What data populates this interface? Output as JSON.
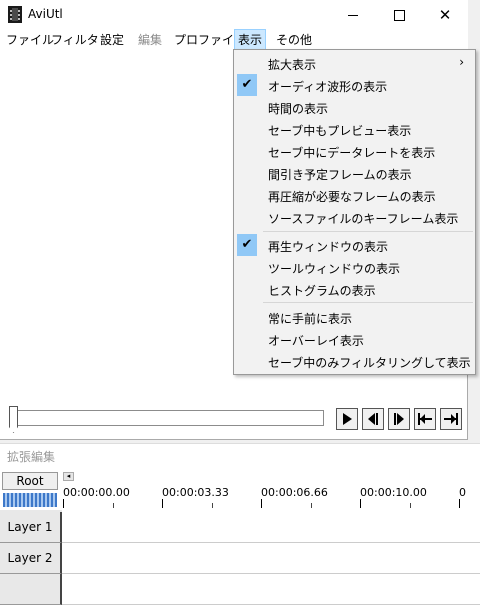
{
  "window": {
    "title": "AviUtl",
    "controls": {
      "minimize": "minimize",
      "maximize": "maximize",
      "close": "✕"
    }
  },
  "menubar": {
    "items": [
      {
        "label": "ファイル",
        "state": "normal"
      },
      {
        "label": "フィルタ",
        "state": "normal"
      },
      {
        "label": "設定",
        "state": "normal"
      },
      {
        "label": "編集",
        "state": "disabled"
      },
      {
        "label": "プロファイル",
        "state": "normal"
      },
      {
        "label": "表示",
        "state": "active"
      },
      {
        "label": "その他",
        "state": "normal"
      }
    ]
  },
  "view_menu": {
    "items": [
      {
        "label": "拡大表示",
        "checked": false,
        "submenu": true
      },
      {
        "label": "オーディオ波形の表示",
        "checked": true
      },
      {
        "label": "時間の表示",
        "checked": false
      },
      {
        "label": "セーブ中もプレビュー表示",
        "checked": false
      },
      {
        "label": "セーブ中にデータレートを表示",
        "checked": false
      },
      {
        "label": "間引き予定フレームの表示",
        "checked": false
      },
      {
        "label": "再圧縮が必要なフレームの表示",
        "checked": false
      },
      {
        "label": "ソースファイルのキーフレーム表示",
        "checked": false
      },
      {
        "label": "再生ウィンドウの表示",
        "checked": true
      },
      {
        "label": "ツールウィンドウの表示",
        "checked": false
      },
      {
        "label": "ヒストグラムの表示",
        "checked": false
      },
      {
        "label": "常に手前に表示",
        "checked": false
      },
      {
        "label": "オーバーレイ表示",
        "checked": false
      },
      {
        "label": "セーブ中のみフィルタリングして表示",
        "checked": false
      }
    ],
    "submenu_arrow": "›",
    "check_glyph": "✔"
  },
  "playback": {
    "seek_position": 0
  },
  "timeline": {
    "title": "拡張編集",
    "root_label": "Root",
    "time_labels": [
      "00:00:00.00",
      "00:00:03.33",
      "00:00:06.66",
      "00:00:10.00",
      "0"
    ],
    "layers": [
      "Layer 1",
      "Layer 2"
    ]
  },
  "colors": {
    "menu_highlight": "#cce8ff",
    "check_background": "#90c8f6",
    "waveform": "#3d78c9"
  }
}
